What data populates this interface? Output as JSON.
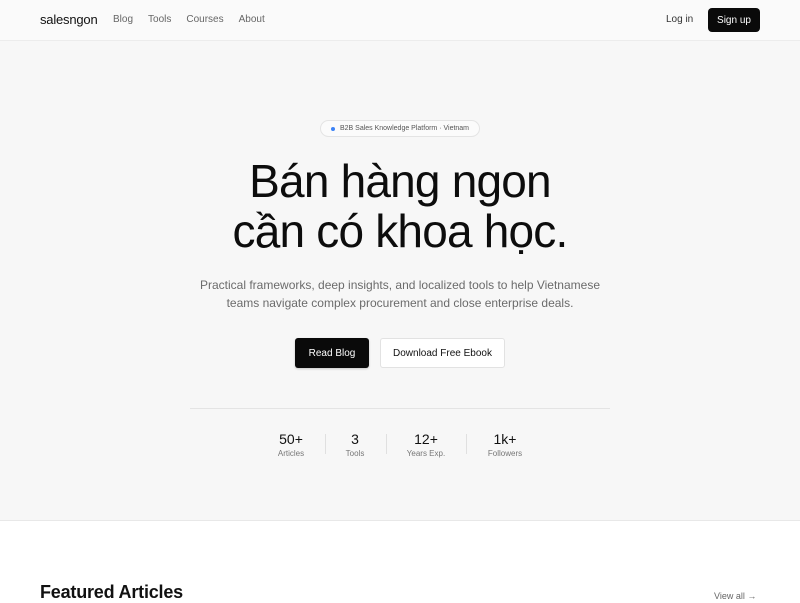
{
  "nav": {
    "logo": "salesngon",
    "links": [
      "Blog",
      "Tools",
      "Courses",
      "About"
    ],
    "login": "Log in",
    "signup": "Sign up"
  },
  "hero": {
    "badge": "B2B Sales Knowledge Platform · Vietnam",
    "headline_line1": "Bán hàng ngon",
    "headline_line2": "cần có khoa học.",
    "subtitle_line1": "Practical frameworks, deep insights, and localized tools to help Vietnamese",
    "subtitle_line2": "teams navigate complex procurement and close enterprise deals.",
    "primary_button": "Read Blog",
    "secondary_button": "Download Free Ebook",
    "stats": [
      {
        "value": "50+",
        "label": "Articles"
      },
      {
        "value": "3",
        "label": "Tools"
      },
      {
        "value": "12+",
        "label": "Years Exp."
      },
      {
        "value": "1k+",
        "label": "Followers"
      }
    ]
  },
  "featured": {
    "title": "Featured Articles",
    "view_all": "View all →"
  },
  "colors": {
    "accent_dot": "#3b82f6",
    "primary_button": "#0a0a0a",
    "hero_background": "#f7f7f7"
  }
}
